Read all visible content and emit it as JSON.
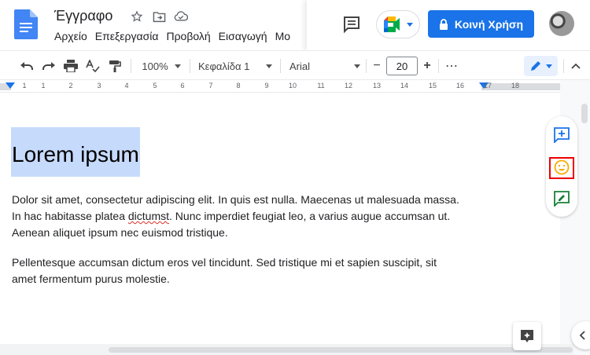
{
  "header": {
    "doc_title": "Έγγραφο",
    "menu": [
      "Αρχείο",
      "Επεξεργασία",
      "Προβολή",
      "Εισαγωγή",
      "Μο"
    ],
    "share_label": "Κοινή Χρήση"
  },
  "toolbar": {
    "zoom": "100%",
    "style": "Κεφαλίδα 1",
    "font": "Arial",
    "font_size": "20",
    "minus": "−",
    "plus": "+",
    "more": "⋯"
  },
  "ruler": {
    "marks": [
      "1",
      "1",
      "2",
      "3",
      "4",
      "5",
      "6",
      "7",
      "8",
      "9",
      "10",
      "11",
      "12",
      "13",
      "14",
      "15",
      "16",
      "17",
      "18"
    ]
  },
  "document": {
    "heading": "Lorem ipsum",
    "para1_a": "Dolor sit amet, consectetur adipiscing elit. In quis est nulla. Maecenas ut malesuada massa.",
    "para1_b_pre": "In hac habitasse platea ",
    "para1_b_err": "dictumst",
    "para1_b_post": ". Nunc imperdiet feugiat leo, a varius augue accumsan ut.",
    "para1_c": "Aenean aliquet ipsum nec euismod tristique.",
    "para2_a": "Pellentesque accumsan dictum eros vel tincidunt. Sed tristique mi et sapien suscipit, sit",
    "para2_b": "amet fermentum purus molestie."
  },
  "colors": {
    "accent": "#1a73e8",
    "selection": "#c6dafc",
    "emoji_yellow": "#f9ab00",
    "suggest_green": "#188038",
    "highlight_red": "#e00000"
  }
}
